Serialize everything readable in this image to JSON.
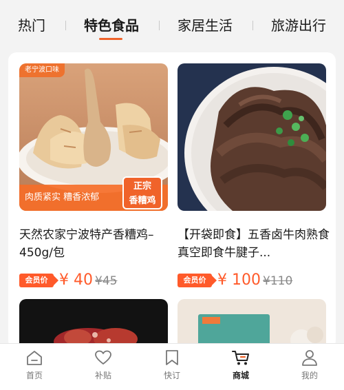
{
  "colors": {
    "accent": "#f0632a",
    "price": "#ff5a2a",
    "nav_inactive": "#888888",
    "nav_active": "#222222"
  },
  "tabs": [
    {
      "label": "热门",
      "active": false
    },
    {
      "label": "特色食品",
      "active": true
    },
    {
      "label": "家居生活",
      "active": false
    },
    {
      "label": "旅游出行",
      "active": false
    }
  ],
  "products": [
    {
      "title": "天然农家宁波特产香糟鸡–450g/包",
      "image_tag": "老宁波口味",
      "image_band_text": "肉质紧实 糟香浓郁",
      "image_badge_line1": "正宗",
      "image_badge_line2": "香糟鸡",
      "member_badge": "会员价",
      "price": "¥ 40",
      "original_price": "¥45"
    },
    {
      "title": "【开袋即食】五香卤牛肉熟食真空即食牛腱子...",
      "member_badge": "会员价",
      "price": "¥ 100",
      "original_price": "¥110"
    }
  ],
  "bottom_nav": [
    {
      "label": "首页",
      "icon": "home-icon",
      "active": false
    },
    {
      "label": "补贴",
      "icon": "heart-icon",
      "active": false
    },
    {
      "label": "快订",
      "icon": "bookmark-icon",
      "active": false
    },
    {
      "label": "商城",
      "icon": "cart-icon",
      "active": true
    },
    {
      "label": "我的",
      "icon": "user-icon",
      "active": false
    }
  ]
}
